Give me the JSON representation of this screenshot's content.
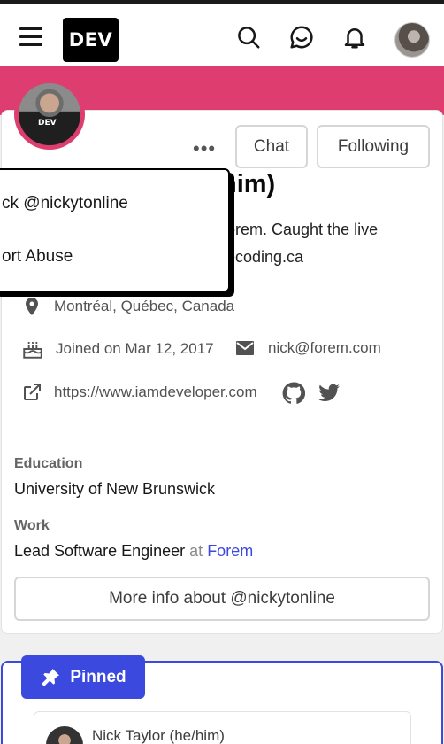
{
  "header": {
    "logo_text": "DEV",
    "icons": [
      "hamburger-icon",
      "search-icon",
      "chat-icon",
      "notifications-icon",
      "user-avatar"
    ]
  },
  "profile": {
    "name_visible": "him)",
    "bio_line1": "orem. Caught the live",
    "bio_line2": "ecoding.ca",
    "avatar_shirt_text": "DEV",
    "location": "Montréal, Québec, Canada",
    "joined": "Joined on Mar 12, 2017",
    "email": "nick@forem.com",
    "website": "https://www.iamdeveloper.com",
    "social_icons": [
      "github-icon",
      "twitter-icon"
    ]
  },
  "actions": {
    "more_label": "•••",
    "chat_label": "Chat",
    "following_label": "Following"
  },
  "dropdown": {
    "item1": "ck @nickytonline",
    "item2": "ort Abuse"
  },
  "details": {
    "education_label": "Education",
    "education_value": "University of New Brunswick",
    "work_label": "Work",
    "work_role": "Lead Software Engineer",
    "work_at": "at",
    "work_company": "Forem",
    "more_info_label": "More info about @nickytonline"
  },
  "pinned": {
    "badge_label": "Pinned",
    "author": "Nick Taylor (he/him)"
  },
  "colors": {
    "banner": "#dd3e6f",
    "accent": "#3b49df"
  }
}
